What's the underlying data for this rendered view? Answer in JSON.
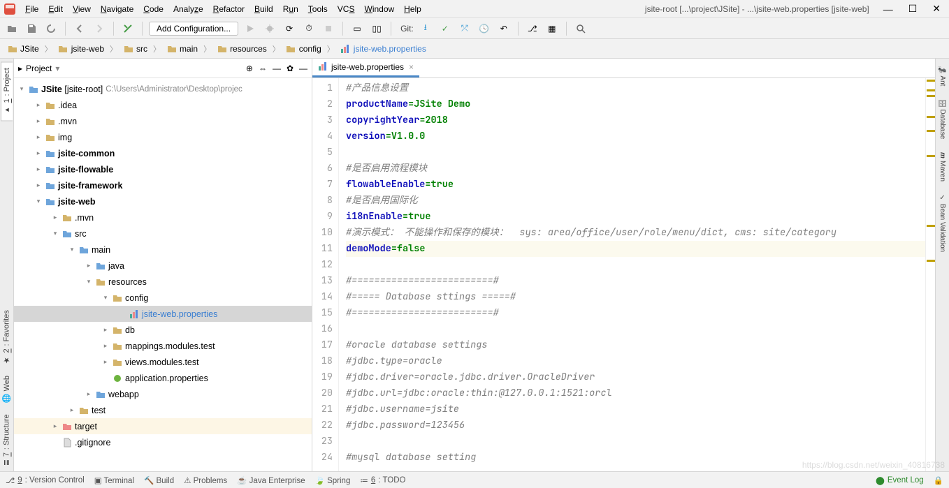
{
  "menu": {
    "items": [
      "File",
      "Edit",
      "View",
      "Navigate",
      "Code",
      "Analyze",
      "Refactor",
      "Build",
      "Run",
      "Tools",
      "VCS",
      "Window",
      "Help"
    ]
  },
  "title": "jsite-root [...\\project\\JSite] - ...\\jsite-web.properties [jsite-web]",
  "toolbar": {
    "config": "Add Configuration...",
    "git": "Git:"
  },
  "breadcrumbs": [
    "JSite",
    "jsite-web",
    "src",
    "main",
    "resources",
    "config",
    "jsite-web.properties"
  ],
  "sidebar": {
    "title": "Project",
    "root": {
      "name": "JSite",
      "module": "[jsite-root]",
      "path": "C:\\Users\\Administrator\\Desktop\\projec"
    },
    "nodes": [
      {
        "d": 1,
        "a": ">",
        "i": "dir",
        "t": ".idea"
      },
      {
        "d": 1,
        "a": ">",
        "i": "dir",
        "t": ".mvn"
      },
      {
        "d": 1,
        "a": ">",
        "i": "dir",
        "t": "img"
      },
      {
        "d": 1,
        "a": ">",
        "i": "mod",
        "t": "jsite-common",
        "b": true
      },
      {
        "d": 1,
        "a": ">",
        "i": "mod",
        "t": "jsite-flowable",
        "b": true
      },
      {
        "d": 1,
        "a": ">",
        "i": "mod",
        "t": "jsite-framework",
        "b": true
      },
      {
        "d": 1,
        "a": "v",
        "i": "mod",
        "t": "jsite-web",
        "b": true
      },
      {
        "d": 2,
        "a": ">",
        "i": "dir",
        "t": ".mvn"
      },
      {
        "d": 2,
        "a": "v",
        "i": "src",
        "t": "src"
      },
      {
        "d": 3,
        "a": "v",
        "i": "src",
        "t": "main"
      },
      {
        "d": 4,
        "a": ">",
        "i": "src",
        "t": "java"
      },
      {
        "d": 4,
        "a": "v",
        "i": "res",
        "t": "resources"
      },
      {
        "d": 5,
        "a": "v",
        "i": "dir",
        "t": "config"
      },
      {
        "d": 6,
        "a": "",
        "i": "prop",
        "t": "jsite-web.properties",
        "sel": true,
        "blue": true
      },
      {
        "d": 5,
        "a": ">",
        "i": "dir",
        "t": "db"
      },
      {
        "d": 5,
        "a": ">",
        "i": "dir",
        "t": "mappings.modules.test"
      },
      {
        "d": 5,
        "a": ">",
        "i": "dir",
        "t": "views.modules.test"
      },
      {
        "d": 5,
        "a": "",
        "i": "spr",
        "t": "application.properties"
      },
      {
        "d": 4,
        "a": ">",
        "i": "web",
        "t": "webapp"
      },
      {
        "d": 3,
        "a": ">",
        "i": "dir",
        "t": "test"
      },
      {
        "d": 2,
        "a": ">",
        "i": "tgt",
        "t": "target",
        "hl": true
      },
      {
        "d": 2,
        "a": "",
        "i": "file",
        "t": ".gitignore"
      }
    ]
  },
  "editor": {
    "tab": "jsite-web.properties",
    "lines": [
      "#产品信息设置",
      "productName=JSite Demo",
      "copyrightYear=2018",
      "version=V1.0.0",
      "",
      "#是否启用流程模块",
      "flowableEnable=true",
      "#是否启用国际化",
      "i18nEnable=true",
      "#演示模式： 不能操作和保存的模块：  sys: area/office/user/role/menu/dict, cms: site/category",
      "demoMode=false",
      "",
      "#=========================#",
      "#===== Database sttings =====#",
      "#=========================#",
      "",
      "#oracle database settings",
      "#jdbc.type=oracle",
      "#jdbc.driver=oracle.jdbc.driver.OracleDriver",
      "#jdbc.url=jdbc:oracle:thin:@127.0.0.1:1521:orcl",
      "#jdbc.username=jsite",
      "#jdbc.password=123456",
      "",
      "#mysql database setting"
    ]
  },
  "rails": {
    "left": [
      "1: Project",
      "2: Favorites",
      "Web",
      "7: Structure"
    ],
    "right": [
      "Ant",
      "Database",
      "Maven",
      "Bean Validation"
    ]
  },
  "status": {
    "items": [
      "9: Version Control",
      "Terminal",
      "Build",
      "Problems",
      "Java Enterprise",
      "Spring",
      "6: TODO"
    ],
    "eventlog": "Event Log"
  },
  "watermark": "https://blog.csdn.net/weixin_40816738"
}
